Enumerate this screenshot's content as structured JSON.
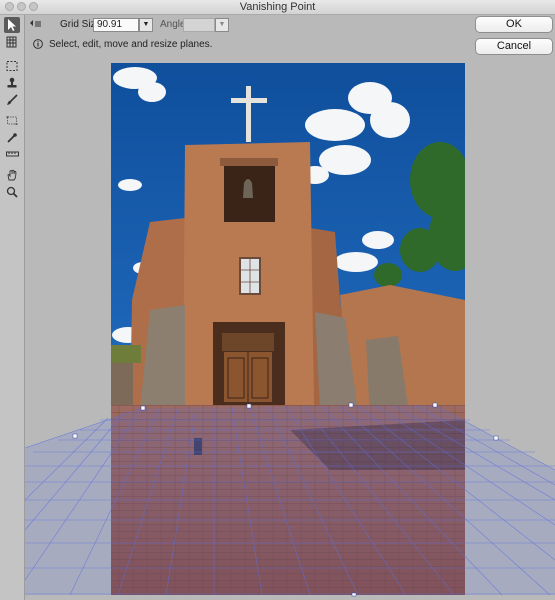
{
  "window": {
    "title": "Vanishing Point"
  },
  "options": {
    "grid_size_label": "Grid Size:",
    "grid_size_value": "90.91",
    "angle_label": "Angle:",
    "angle_value": ""
  },
  "info": {
    "message": "Select, edit, move and resize planes."
  },
  "buttons": {
    "ok": "OK",
    "cancel": "Cancel"
  },
  "tools": [
    {
      "name": "edit-plane-tool",
      "icon": "arrow-icon",
      "active": true
    },
    {
      "name": "create-plane-tool",
      "icon": "grid-plane-icon"
    },
    {
      "name": "marquee-tool",
      "icon": "marquee-icon"
    },
    {
      "name": "stamp-tool",
      "icon": "stamp-icon"
    },
    {
      "name": "brush-tool",
      "icon": "brush-icon"
    },
    {
      "name": "transform-tool",
      "icon": "transform-icon"
    },
    {
      "name": "eyedropper-tool",
      "icon": "eyedropper-icon"
    },
    {
      "name": "measure-tool",
      "icon": "ruler-icon"
    },
    {
      "name": "hand-tool",
      "icon": "hand-icon"
    },
    {
      "name": "zoom-tool",
      "icon": "zoom-icon"
    }
  ],
  "colors": {
    "plane_grid": "#5a6fe0",
    "sky": "#1c5fb0",
    "adobe": "#b4764e"
  }
}
